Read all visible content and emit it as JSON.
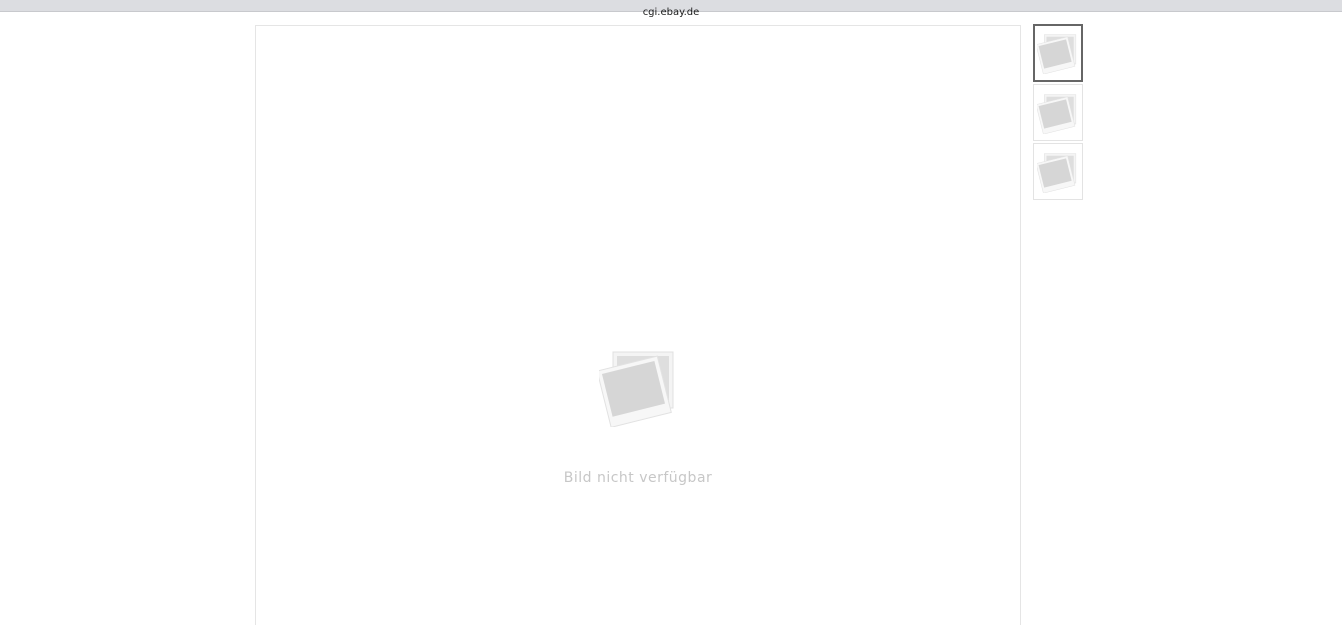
{
  "window": {
    "title": "cgi.ebay.de"
  },
  "viewer": {
    "placeholder_text": "Bild nicht verfügbar",
    "placeholder_icon": "photo-unavailable-icon"
  },
  "thumbnails": [
    {
      "icon": "photo-unavailable-icon",
      "selected": true
    },
    {
      "icon": "photo-unavailable-icon",
      "selected": false
    },
    {
      "icon": "photo-unavailable-icon",
      "selected": false
    }
  ],
  "colors": {
    "placeholder_text": "#c7c7c7",
    "selected_border": "#666666",
    "titlebar_bg": "#dcdde1"
  }
}
